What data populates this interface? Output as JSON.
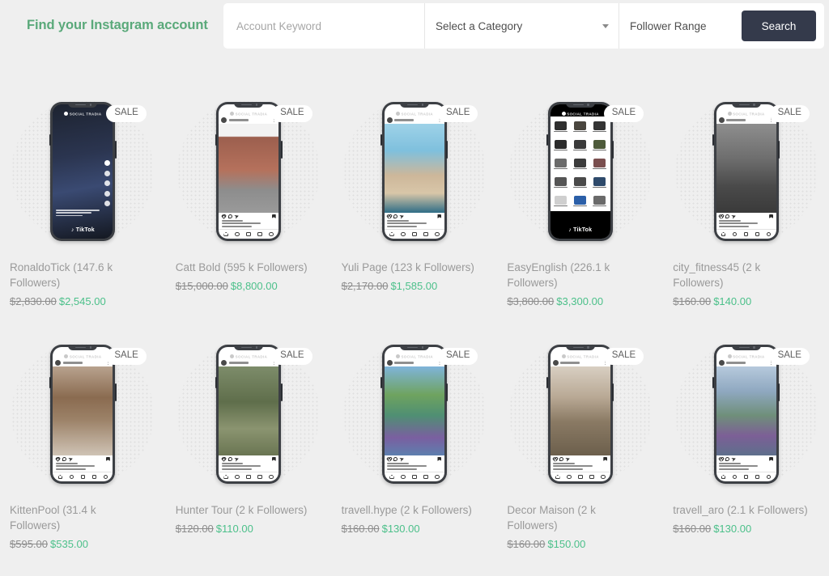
{
  "header": {
    "title": "Find your Instagram account",
    "title_color": "#5aa97a",
    "keyword_placeholder": "Account Keyword",
    "category_label": "Select a Category",
    "follower_label": "Follower Range",
    "search_label": "Search",
    "search_button_color": "#343a4b"
  },
  "badge_label": "SALE",
  "products": [
    {
      "title": "RonaldoTick (147.6 k Followers)",
      "price_old": "$2,830.00",
      "price_new": "$2,545.00",
      "screen": "tiktok",
      "brand": "TikTok",
      "watermark": "SOCIAL TRADIA"
    },
    {
      "title": "Catt Bold (595 k Followers)",
      "price_old": "$15,000.00",
      "price_new": "$8,800.00",
      "screen": "instagram",
      "brand": "",
      "watermark": "SOCIAL TRADIA"
    },
    {
      "title": "Yuli Page (123 k Followers)",
      "price_old": "$2,170.00",
      "price_new": "$1,585.00",
      "screen": "instagram",
      "brand": "",
      "watermark": "SOCIAL TRADIA"
    },
    {
      "title": "EasyEnglish (226.1 k Followers)",
      "price_old": "$3,800.00",
      "price_new": "$3,300.00",
      "screen": "productgrid",
      "brand": "TikTok",
      "watermark": "SOCIAL TRADIA"
    },
    {
      "title": "city_fitness45 (2 k Followers)",
      "price_old": "$160.00",
      "price_new": "$140.00",
      "screen": "instagram",
      "brand": "",
      "watermark": "SOCIAL TRADIA"
    },
    {
      "title": "KittenPool (31.4 k Followers)",
      "price_old": "$595.00",
      "price_new": "$535.00",
      "screen": "instagram",
      "brand": "",
      "watermark": "SOCIAL TRADIA"
    },
    {
      "title": "Hunter Tour (2 k Followers)",
      "price_old": "$120.00",
      "price_new": "$110.00",
      "screen": "instagram",
      "brand": "",
      "watermark": "SOCIAL TRADIA"
    },
    {
      "title": "travell.hype (2 k Followers)",
      "price_old": "$160.00",
      "price_new": "$130.00",
      "screen": "instagram",
      "brand": "",
      "watermark": "SOCIAL TRADIA"
    },
    {
      "title": "Decor Maison (2 k Followers)",
      "price_old": "$160.00",
      "price_new": "$150.00",
      "screen": "instagram",
      "brand": "",
      "watermark": "SOCIAL TRADIA"
    },
    {
      "title": "travell_aro (2.1 k Followers)",
      "price_old": "$160.00",
      "price_new": "$130.00",
      "screen": "instagram",
      "brand": "",
      "watermark": "SOCIAL TRADIA"
    }
  ]
}
